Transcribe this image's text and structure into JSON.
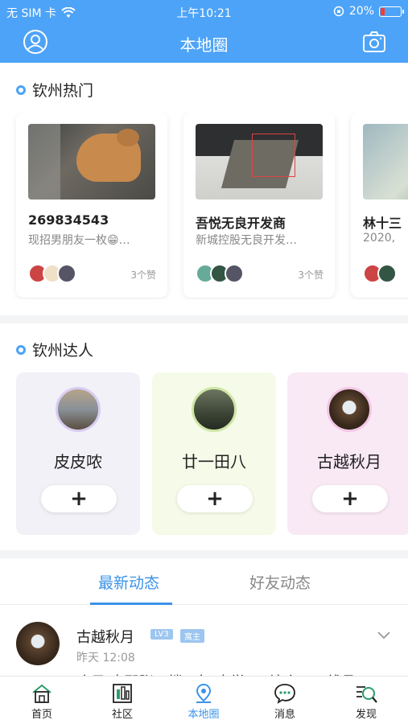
{
  "status_bar": {
    "carrier": "无 SIM 卡",
    "time": "上午10:21",
    "battery": "20%",
    "battery_level": 0.2
  },
  "nav": {
    "title": "本地圈",
    "profile_icon": "user-circle-icon",
    "camera_icon": "camera-icon"
  },
  "hot_section": {
    "title": "钦州热门",
    "cards": [
      {
        "name": "269834543",
        "desc": "现招男朋友一枚😁…",
        "likes": "3个赞"
      },
      {
        "name": "吾悦无良开发商",
        "desc": "新城控股无良开发…",
        "likes": "3个赞"
      },
      {
        "name": "林十三",
        "desc": "2020,",
        "likes": ""
      }
    ]
  },
  "talent_section": {
    "title": "钦州达人",
    "people": [
      {
        "name": "皮皮哝",
        "follow": "+"
      },
      {
        "name": "廿一田八",
        "follow": "+"
      },
      {
        "name": "古越秋月",
        "follow": "+"
      }
    ]
  },
  "feed_tabs": {
    "latest": "最新动态",
    "friends": "好友动态"
  },
  "post": {
    "author": "古越秋月",
    "level": "LV3",
    "role": "寓主",
    "time": "昨天 12:08",
    "text": "昨日 去那张一楼下年 中学 一 站合一…线县"
  },
  "tabbar": {
    "items": [
      {
        "label": "首页",
        "icon": "home-icon"
      },
      {
        "label": "社区",
        "icon": "community-icon"
      },
      {
        "label": "本地圈",
        "icon": "location-icon"
      },
      {
        "label": "消息",
        "icon": "message-icon"
      },
      {
        "label": "发现",
        "icon": "discover-icon"
      }
    ]
  },
  "colors": {
    "primary": "#4da3f7",
    "active": "#3b93e8",
    "talent_bg_1": "#f1f1f7",
    "talent_bg_2": "#f5fbe8",
    "talent_bg_3": "#f9e9f5"
  }
}
